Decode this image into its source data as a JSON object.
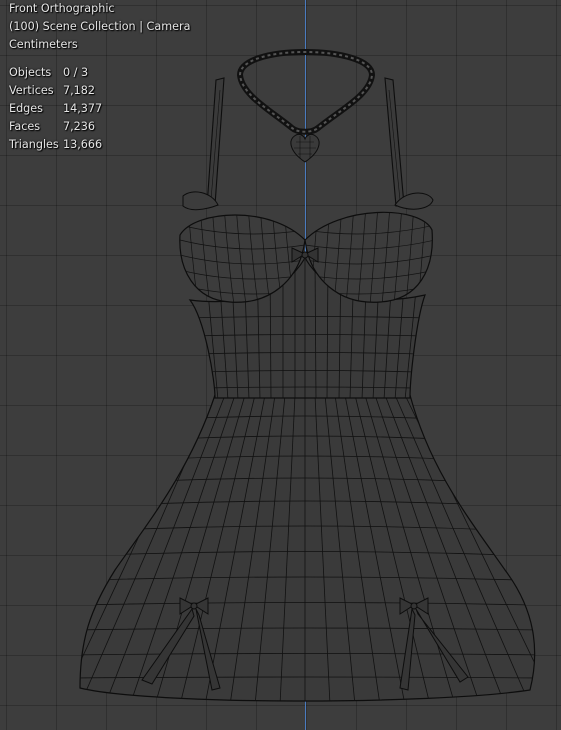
{
  "viewport": {
    "view_name": "Front Orthographic",
    "collection": "(100) Scene Collection | Camera",
    "units": "Centimeters"
  },
  "stats": [
    {
      "label": "Objects",
      "value": "0 / 3"
    },
    {
      "label": "Vertices",
      "value": "7,182"
    },
    {
      "label": "Edges",
      "value": "14,377"
    },
    {
      "label": "Faces",
      "value": "7,236"
    },
    {
      "label": "Triangles",
      "value": "13,666"
    }
  ],
  "colors": {
    "background": "#3d3d3d",
    "grid": "#333333",
    "axis_z": "#4a7bbf",
    "wireframe": "#0d0d0d",
    "overlay_text": "#e6e6e6"
  },
  "objects": [
    "dress-mesh",
    "necklace-mesh",
    "bow-left",
    "bow-right"
  ]
}
